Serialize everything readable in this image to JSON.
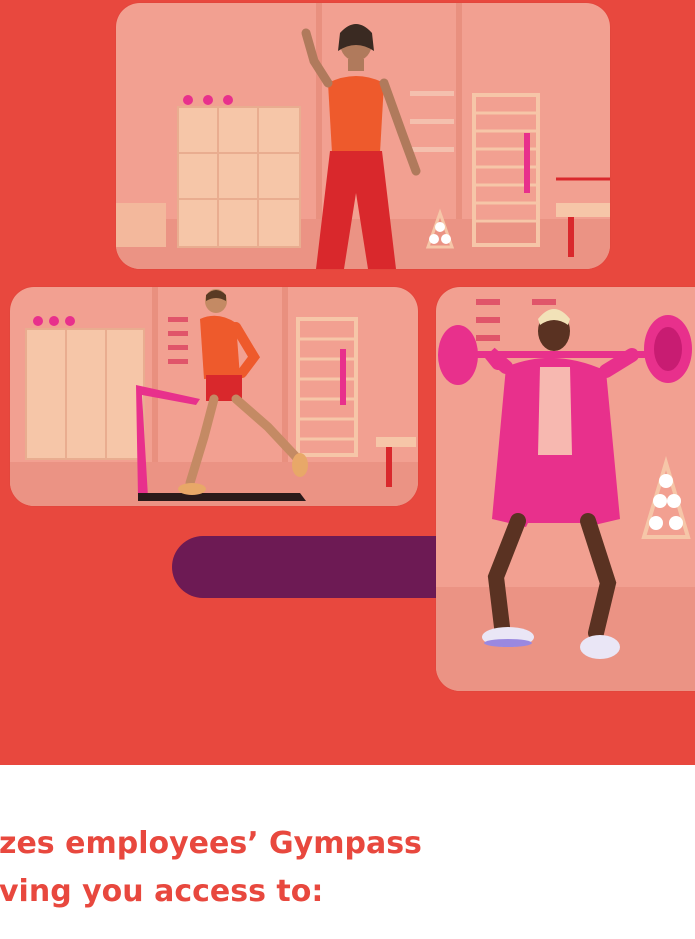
{
  "colors": {
    "hero_background": "#e8483e",
    "accent_pill": "#6d1a54",
    "headline_text": "#e8483e",
    "room_wall": "#f2a091",
    "room_floor": "#eb9384",
    "outfit_orange": "#ee5a2c",
    "outfit_red": "#d9282c",
    "outfit_pink": "#e8308c"
  },
  "photos": [
    {
      "subject": "woman-dancing-in-pink-gym"
    },
    {
      "subject": "man-running-on-treadmill"
    },
    {
      "subject": "woman-squatting-with-barbell"
    }
  ],
  "headline": {
    "line1": "zes employees’ Gympass",
    "line2": "ving you access to:"
  }
}
